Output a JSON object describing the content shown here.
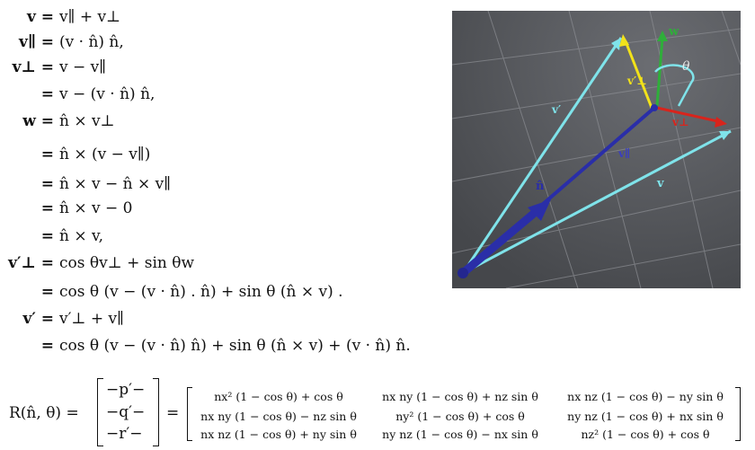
{
  "equations": [
    {
      "lhs": "v =",
      "rhs": "v∥ + v⊥"
    },
    {
      "lhs": "v∥ =",
      "rhs": "(v · n̂) n̂,"
    },
    {
      "lhs": "v⊥ =",
      "rhs": "v − v∥"
    },
    {
      "lhs": "=",
      "rhs": "v − (v · n̂) n̂,"
    },
    {
      "lhs": "w =",
      "rhs": "n̂ × v⊥"
    },
    {
      "lhs": "=",
      "rhs": "n̂ × (v − v∥)"
    },
    {
      "lhs": "=",
      "rhs": "n̂ × v − n̂ × v∥"
    },
    {
      "lhs": "=",
      "rhs": "n̂ × v − 0"
    },
    {
      "lhs": "=",
      "rhs": "n̂ × v,"
    },
    {
      "lhs": "v′⊥ =",
      "rhs": "cos θv⊥ + sin θw"
    },
    {
      "lhs": "=",
      "rhs": "cos θ (v − (v · n̂) . n̂) + sin θ (n̂ × v) ."
    },
    {
      "lhs": "v′ =",
      "rhs": "v′⊥ + v∥"
    },
    {
      "lhs": "=",
      "rhs": "cos θ (v − (v · n̂) n̂) + sin θ (n̂ × v) + (v · n̂) n̂."
    }
  ],
  "figure_labels": {
    "w": "w",
    "theta": "θ",
    "v_perp_prime": "v′⊥",
    "v_prime": "v′",
    "v_perp": "v⊥",
    "v_par": "v∥",
    "n_hat": "n̂",
    "v": "v"
  },
  "colors": {
    "figure_bg": "#5a5c60",
    "cyan": "#7fe3ea",
    "blue": "#2a2ea8",
    "yellow": "#f2e21a",
    "green": "#2fae3a",
    "red": "#d8241c"
  },
  "matrix": {
    "lhs": "R(n̂, θ) =",
    "rows_vec": [
      "−p′−",
      "−q′−",
      "−r′−"
    ],
    "eq": "=",
    "cells": [
      [
        "nx² (1 − cos θ) + cos θ",
        "nx ny (1 − cos θ) + nz sin θ",
        "nx nz (1 − cos θ) − ny sin θ"
      ],
      [
        "nx ny (1 − cos θ) − nz sin θ",
        "ny² (1 − cos θ) + cos θ",
        "ny nz (1 − cos θ) + nx sin θ"
      ],
      [
        "nx nz (1 − cos θ) + ny sin θ",
        "ny nz (1 − cos θ) − nx sin θ",
        "nz² (1 − cos θ) + cos θ"
      ]
    ]
  }
}
